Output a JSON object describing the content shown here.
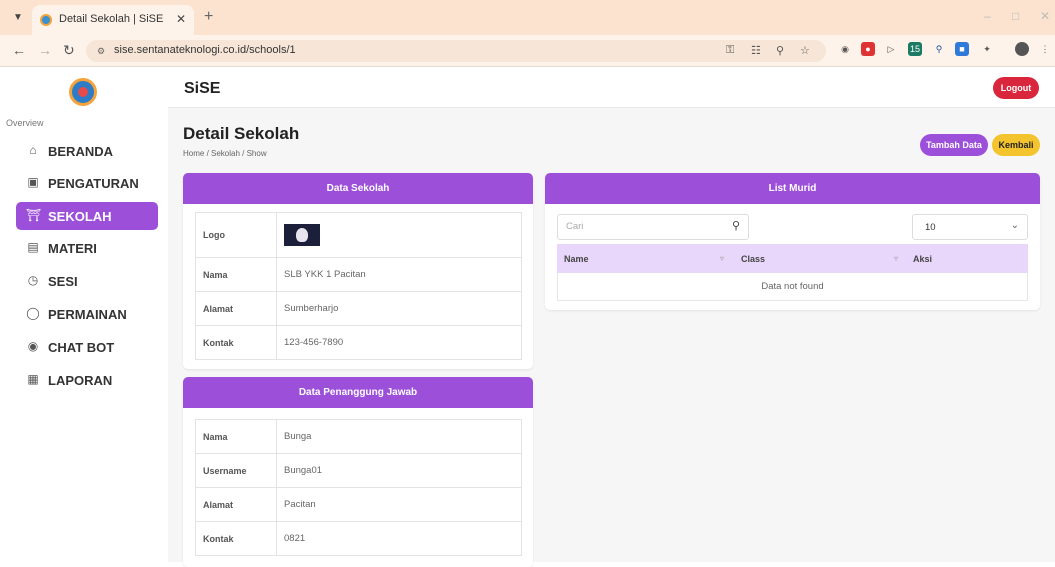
{
  "browser": {
    "tab_title": "Detail Sekolah | SiSE",
    "url": "sise.sentanateknologi.co.id/schools/1"
  },
  "app": {
    "brand": "SiSE",
    "logout_label": "Logout"
  },
  "sidebar": {
    "overview_label": "Overview",
    "items": [
      {
        "label": "BERANDA",
        "icon": "home-icon"
      },
      {
        "label": "PENGATURAN",
        "icon": "settings-icon"
      },
      {
        "label": "SEKOLAH",
        "icon": "school-icon",
        "active": true
      },
      {
        "label": "MATERI",
        "icon": "book-icon"
      },
      {
        "label": "SESI",
        "icon": "clock-icon"
      },
      {
        "label": "PERMAINAN",
        "icon": "gamepad-icon"
      },
      {
        "label": "CHAT BOT",
        "icon": "chat-icon"
      },
      {
        "label": "LAPORAN",
        "icon": "report-icon"
      }
    ]
  },
  "page": {
    "title": "Detail Sekolah",
    "breadcrumb": "Home  /  Sekolah  /  Show",
    "btn_tambah": "Tambah Data",
    "btn_kembali": "Kembali"
  },
  "data_sekolah": {
    "header": "Data Sekolah",
    "rows": [
      {
        "key": "Logo",
        "value": ""
      },
      {
        "key": "Nama",
        "value": "SLB YKK 1 Pacitan"
      },
      {
        "key": "Alamat",
        "value": "Sumberharjo"
      },
      {
        "key": "Kontak",
        "value": "123-456-7890"
      }
    ]
  },
  "penanggung_jawab": {
    "header": "Data Penanggung Jawab",
    "rows": [
      {
        "key": "Nama",
        "value": "Bunga"
      },
      {
        "key": "Username",
        "value": "Bunga01"
      },
      {
        "key": "Alamat",
        "value": "Pacitan"
      },
      {
        "key": "Kontak",
        "value": "0821"
      }
    ]
  },
  "list_murid": {
    "header": "List Murid",
    "search_placeholder": "Cari",
    "page_size": "10",
    "columns": [
      "Name",
      "Class",
      "Aksi"
    ],
    "empty_text": "Data not found"
  },
  "colors": {
    "primary": "#9c4fd9",
    "danger": "#d9263c",
    "warning": "#f3c42e"
  }
}
